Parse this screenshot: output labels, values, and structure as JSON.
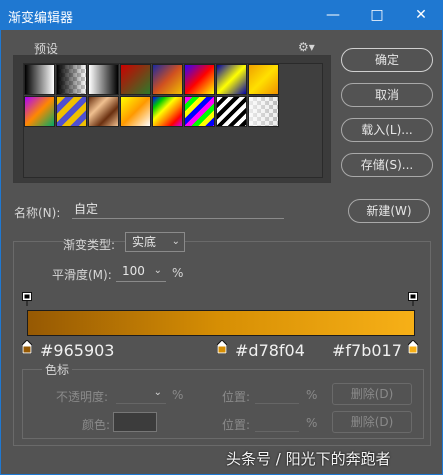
{
  "window": {
    "title": "渐变编辑器",
    "min_glyph": "—",
    "max_glyph": "□",
    "close_glyph": "✕",
    "accent": "#1f78d1"
  },
  "presets": {
    "label": "预设",
    "gear_glyph": "⚙▾"
  },
  "buttons": {
    "ok": "确定",
    "cancel": "取消",
    "load": "载入(L)...",
    "save": "存储(S)...",
    "new": "新建(W)"
  },
  "name": {
    "label": "名称(N):",
    "value": "自定"
  },
  "gradient_type": {
    "label": "渐变类型:",
    "value": "实底"
  },
  "smoothness": {
    "label": "平滑度(M):",
    "value": "100",
    "unit": "%"
  },
  "gradient": {
    "stops": [
      {
        "color": "#965903",
        "label": "#965903"
      },
      {
        "color": "#d78f04",
        "label": "#d78f04"
      },
      {
        "color": "#f7b017",
        "label": "#f7b017"
      }
    ]
  },
  "color_stop": {
    "group_label": "色标",
    "opacity_label": "不透明度:",
    "opacity_unit": "%",
    "location_label": "位置:",
    "location_unit": "%",
    "delete_label": "删除(D)",
    "color_label": "颜色:"
  },
  "watermark": "头条号 / 阳光下的奔跑者"
}
